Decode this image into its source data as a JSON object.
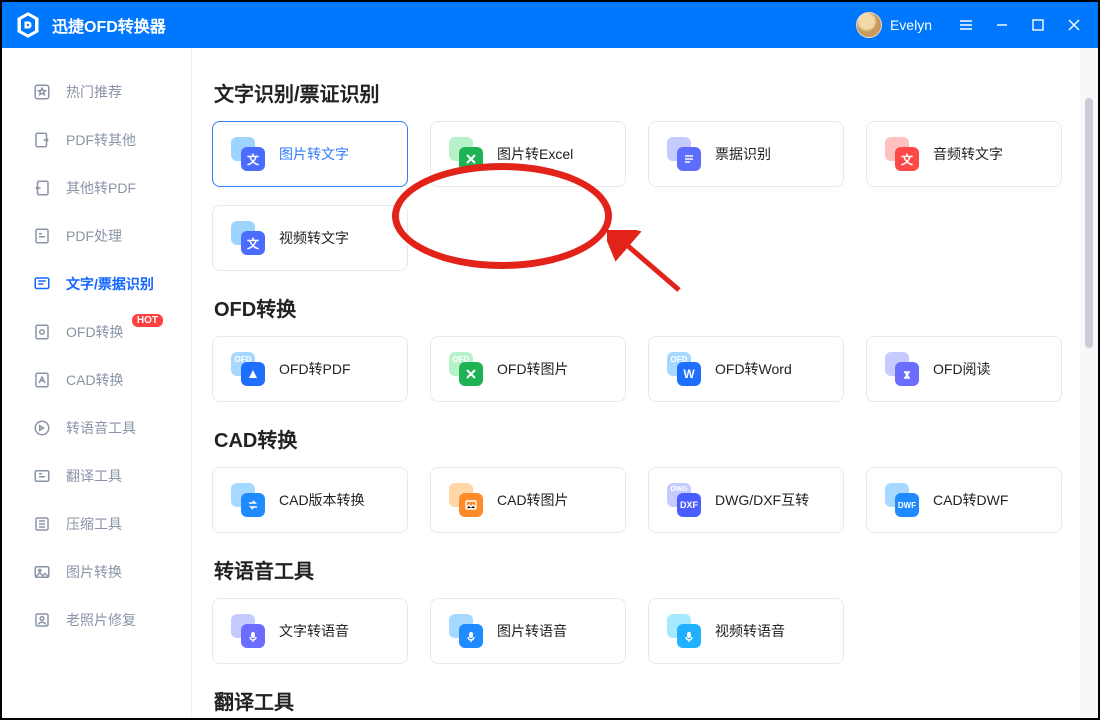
{
  "app": {
    "title": "迅捷OFD转换器"
  },
  "user": {
    "name": "Evelyn"
  },
  "sidebar": {
    "items": [
      {
        "label": "热门推荐"
      },
      {
        "label": "PDF转其他"
      },
      {
        "label": "其他转PDF"
      },
      {
        "label": "PDF处理"
      },
      {
        "label": "文字/票据识别"
      },
      {
        "label": "OFD转换",
        "hot": "HOT"
      },
      {
        "label": "CAD转换"
      },
      {
        "label": "转语音工具"
      },
      {
        "label": "翻译工具"
      },
      {
        "label": "压缩工具"
      },
      {
        "label": "图片转换"
      },
      {
        "label": "老照片修复"
      }
    ]
  },
  "sections": [
    {
      "title": "文字识别/票证识别",
      "cards": [
        {
          "label": "图片转文字"
        },
        {
          "label": "图片转Excel"
        },
        {
          "label": "票据识别"
        },
        {
          "label": "音频转文字"
        },
        {
          "label": "视频转文字"
        }
      ]
    },
    {
      "title": "OFD转换",
      "cards": [
        {
          "label": "OFD转PDF"
        },
        {
          "label": "OFD转图片"
        },
        {
          "label": "OFD转Word"
        },
        {
          "label": "OFD阅读"
        }
      ]
    },
    {
      "title": "CAD转换",
      "cards": [
        {
          "label": "CAD版本转换"
        },
        {
          "label": "CAD转图片"
        },
        {
          "label": "DWG/DXF互转"
        },
        {
          "label": "CAD转DWF"
        }
      ]
    },
    {
      "title": "转语音工具",
      "cards": [
        {
          "label": "文字转语音"
        },
        {
          "label": "图片转语音"
        },
        {
          "label": "视频转语音"
        }
      ]
    },
    {
      "title": "翻译工具",
      "cards": []
    }
  ],
  "icons": {
    "txt": "文"
  }
}
